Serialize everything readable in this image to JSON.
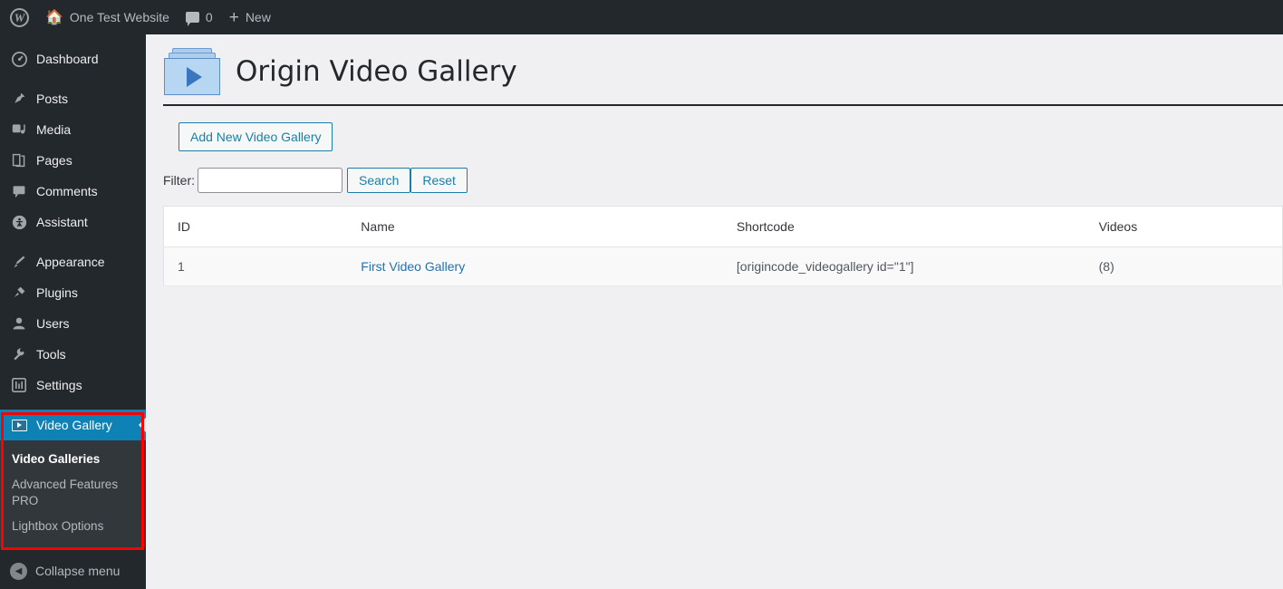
{
  "adminbar": {
    "site_name": "One Test Website",
    "comment_count": "0",
    "new_label": "New",
    "wp_logo": "wordpress-logo-icon",
    "home_icon": "home-icon",
    "comment_icon": "comment-bubble-icon",
    "plus_icon": "plus-icon"
  },
  "sidebar": {
    "items": [
      {
        "label": "Dashboard",
        "icon": "dashboard-icon",
        "glyph": "◔"
      },
      {
        "label": "Posts",
        "icon": "pin-icon",
        "glyph": "📌"
      },
      {
        "label": "Media",
        "icon": "media-icon",
        "glyph": "♫"
      },
      {
        "label": "Pages",
        "icon": "pages-icon",
        "glyph": "❐"
      },
      {
        "label": "Comments",
        "icon": "comments-icon",
        "glyph": "🗨"
      },
      {
        "label": "Assistant",
        "icon": "assistant-icon",
        "glyph": "☯"
      },
      {
        "label": "Appearance",
        "icon": "brush-icon",
        "glyph": "🖌"
      },
      {
        "label": "Plugins",
        "icon": "plug-icon",
        "glyph": "⚡"
      },
      {
        "label": "Users",
        "icon": "user-icon",
        "glyph": "👤"
      },
      {
        "label": "Tools",
        "icon": "wrench-icon",
        "glyph": "🔧"
      },
      {
        "label": "Settings",
        "icon": "settings-sliders-icon",
        "glyph": "⇅"
      }
    ],
    "current_item": {
      "label": "Video Gallery",
      "icon": "video-gallery-icon"
    },
    "submenu": [
      {
        "label": "Video Galleries",
        "current": true
      },
      {
        "label": "Advanced Features PRO",
        "current": false
      },
      {
        "label": "Lightbox Options",
        "current": false
      }
    ],
    "collapse_label": "Collapse menu",
    "collapse_icon": "chevron-left-circle-icon",
    "highlight_color": "#ff0000",
    "active_color": "#0f82b5"
  },
  "page": {
    "title": "Origin Video Gallery",
    "title_icon": "video-folder-icon",
    "add_button": "Add New Video Gallery"
  },
  "filter": {
    "label": "Filter:",
    "value": "",
    "placeholder": "",
    "search_label": "Search",
    "reset_label": "Reset"
  },
  "table": {
    "columns": [
      "ID",
      "Name",
      "Shortcode",
      "Videos"
    ],
    "rows": [
      {
        "id": "1",
        "name": "First Video Gallery",
        "shortcode": "[origincode_videogallery id=\"1\"]",
        "videos": "(8)"
      }
    ]
  }
}
